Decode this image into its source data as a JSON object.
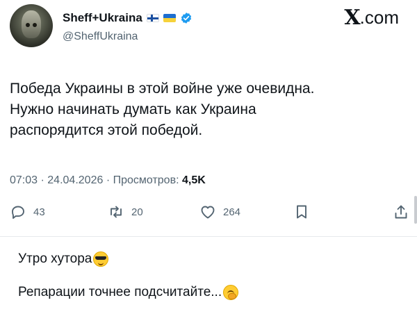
{
  "header": {
    "display_name": "Sheff+Ukraina",
    "handle": "@SheffUkraina",
    "site": {
      "x_glyph": "X",
      "suffix": ".com"
    },
    "flags": [
      "finland-flag-icon",
      "ukraine-flag-icon"
    ],
    "verified_icon": "verified-badge-icon"
  },
  "tweet": {
    "lines": [
      "Победа Украины в этой войне уже очевидна.",
      "Нужно начинать думать как Украина",
      "распорядится этой победой."
    ],
    "time": "07:03",
    "date": "24.04.2026",
    "views_label": "Просмотров:",
    "views_value": "4,5K",
    "separator": "·"
  },
  "actions": {
    "replies": "43",
    "retweets": "20",
    "likes": "264"
  },
  "comments": [
    {
      "text": "Утро хутора",
      "emoji": "smiling-face-with-sunglasses-icon"
    },
    {
      "text": "Репарации точнее подсчитайте...",
      "emoji": "face-with-hand-over-mouth-icon"
    }
  ],
  "colors": {
    "text": "#0f1419",
    "muted": "#536471",
    "verified": "#1d9bf0"
  }
}
